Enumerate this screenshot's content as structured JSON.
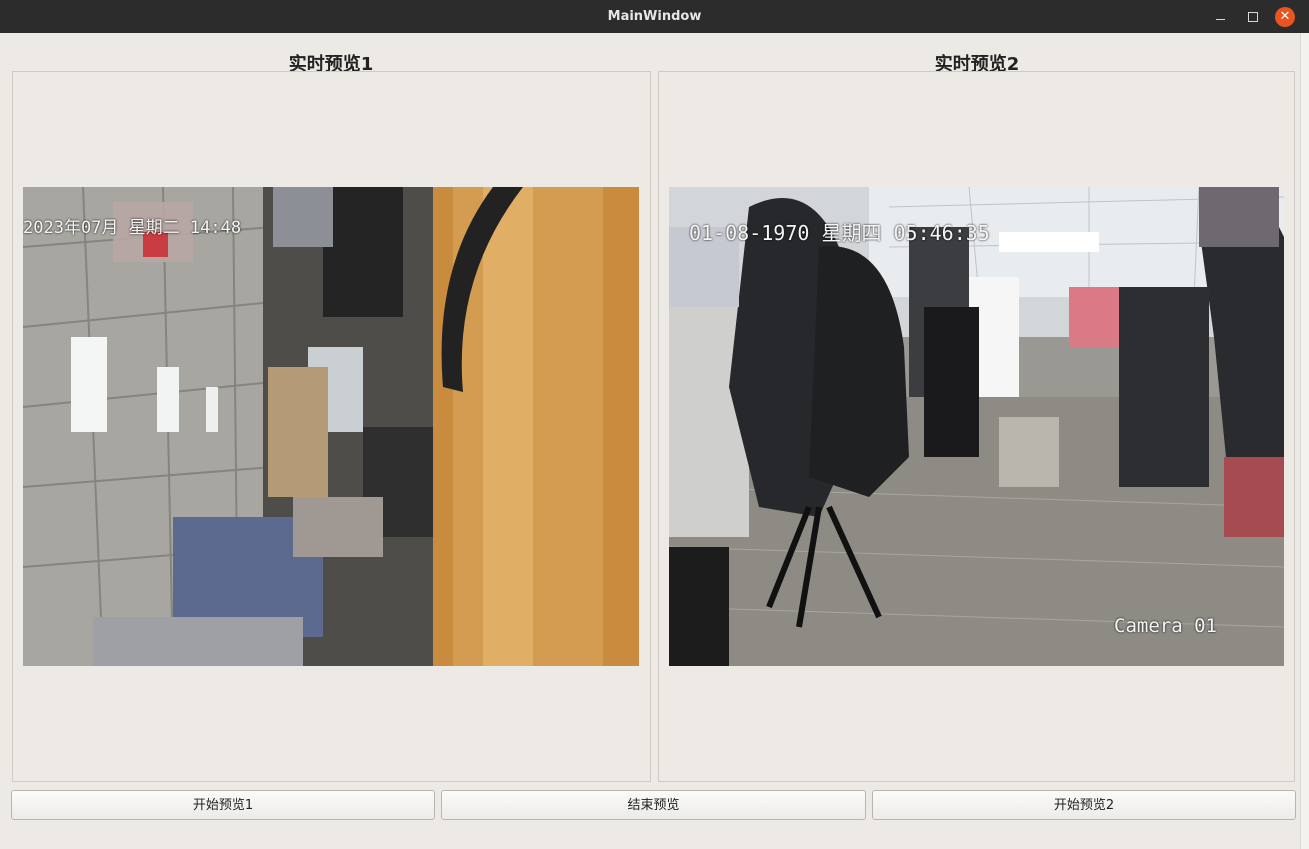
{
  "window": {
    "title": "MainWindow"
  },
  "panels": [
    {
      "title": "实时预览1",
      "osd_text": "2023年07月   星期二 14:48"
    },
    {
      "title": "实时预览2",
      "osd_text": "01-08-1970 星期四 05:46:35",
      "camera_label": "Camera 01"
    }
  ],
  "buttons": {
    "start1": "开始预览1",
    "stop": "结束预览",
    "start2": "开始预览2"
  },
  "colors": {
    "titlebar": "#2c2c2c",
    "close": "#e95420",
    "window_bg": "#edeae5"
  }
}
